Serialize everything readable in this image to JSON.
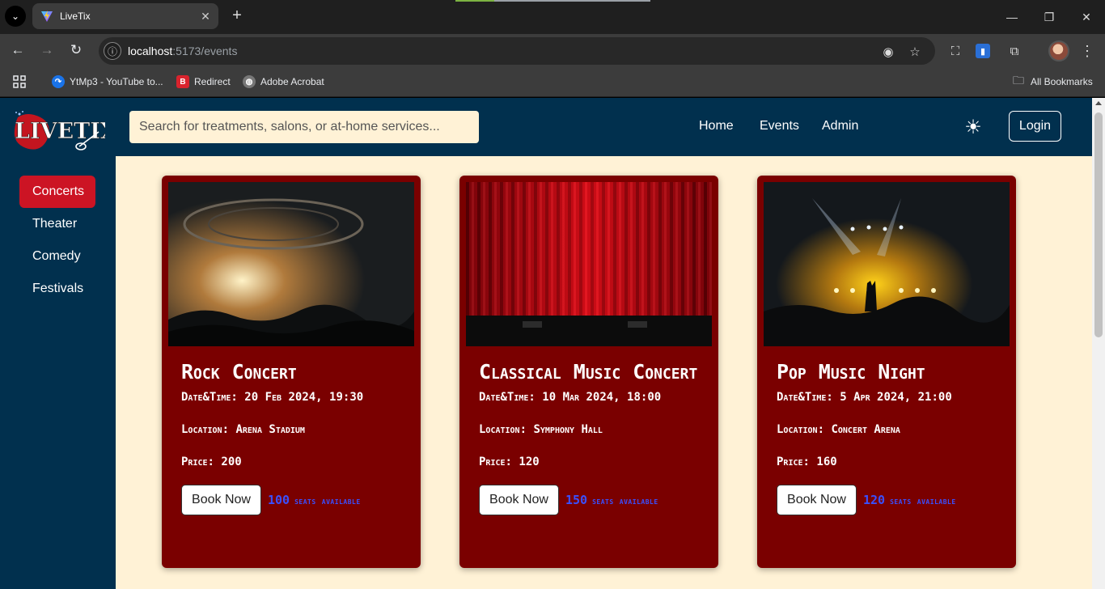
{
  "browser": {
    "tab_title": "LiveTix",
    "url_host": "localhost",
    "url_path": ":5173/events",
    "load_progress": 0.2,
    "bookmarks": [
      {
        "label": "YtMp3 - YouTube to...",
        "icon": "ytmp3-icon"
      },
      {
        "label": "Redirect",
        "icon": "redirect-b-icon"
      },
      {
        "label": "Adobe Acrobat",
        "icon": "globe-icon"
      }
    ],
    "all_bookmarks": "All Bookmarks"
  },
  "header": {
    "logo_text": "LIVETIX",
    "search_placeholder": "Search for treatments, salons, or at-home services...",
    "nav": [
      "Home",
      "Events",
      "Admin"
    ],
    "theme_icon": "sun-icon",
    "login": "Login"
  },
  "sidebar": {
    "categories": [
      "Concerts",
      "Theater",
      "Comedy",
      "Festivals"
    ],
    "active": "Concerts"
  },
  "events": [
    {
      "title": "Rock Concert",
      "datetime_label": "Date&Time:",
      "datetime": "20 Feb 2024, 19:30",
      "location_label": "Location:",
      "location": "Arena Stadium",
      "price_label": "Price:",
      "price": "200",
      "book_label": "Book Now",
      "seats": "100",
      "seats_label": "seats available"
    },
    {
      "title": "Classical Music Concert",
      "datetime_label": "Date&Time:",
      "datetime": "10 Mar 2024, 18:00",
      "location_label": "Location:",
      "location": "Symphony Hall",
      "price_label": "Price:",
      "price": "120",
      "book_label": "Book Now",
      "seats": "150",
      "seats_label": "seats available"
    },
    {
      "title": "Pop Music Night",
      "datetime_label": "Date&Time:",
      "datetime": "5 Apr 2024, 21:00",
      "location_label": "Location:",
      "location": "Concert Arena",
      "price_label": "Price:",
      "price": "160",
      "book_label": "Book Now",
      "seats": "120",
      "seats_label": "seats available"
    }
  ],
  "colors": {
    "header_bg": "#01304e",
    "page_bg": "#fff2d6",
    "card_bg": "#7a0000",
    "active_category": "#cc1424",
    "seats_text": "#3a50ff"
  }
}
